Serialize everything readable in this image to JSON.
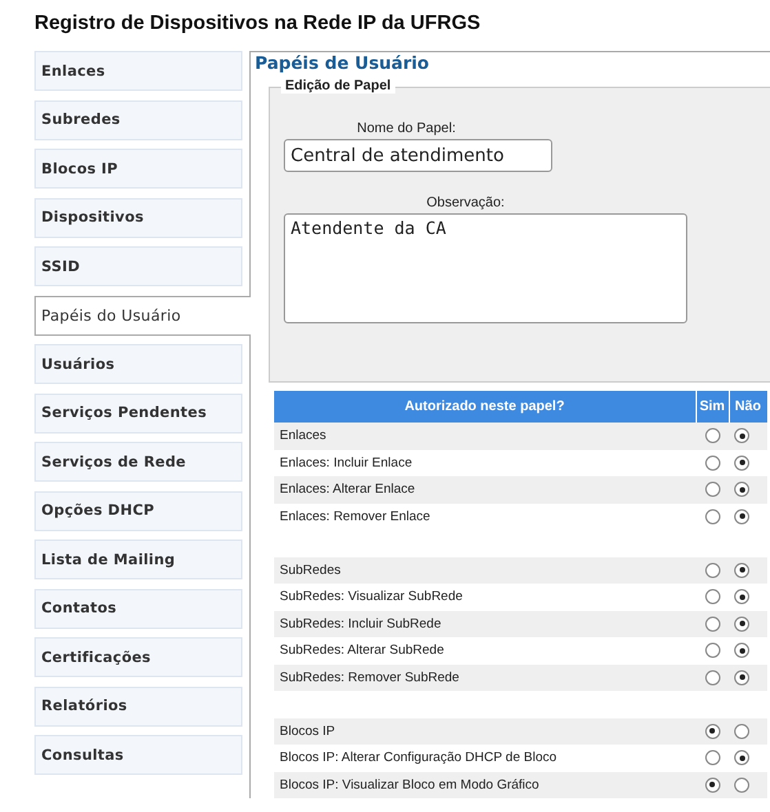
{
  "page_title": "Registro de Dispositivos na Rede IP da UFRGS",
  "sidebar": {
    "items": [
      {
        "label": "Enlaces",
        "selected": false
      },
      {
        "label": "Subredes",
        "selected": false
      },
      {
        "label": "Blocos IP",
        "selected": false
      },
      {
        "label": "Dispositivos",
        "selected": false
      },
      {
        "label": "SSID",
        "selected": false
      },
      {
        "label": "Papéis do Usuário",
        "selected": true
      },
      {
        "label": "Usuários",
        "selected": false
      },
      {
        "label": "Serviços Pendentes",
        "selected": false
      },
      {
        "label": "Serviços de Rede",
        "selected": false
      },
      {
        "label": "Opções DHCP",
        "selected": false
      },
      {
        "label": "Lista de Mailing",
        "selected": false
      },
      {
        "label": "Contatos",
        "selected": false
      },
      {
        "label": "Certificações",
        "selected": false
      },
      {
        "label": "Relatórios",
        "selected": false
      },
      {
        "label": "Consultas",
        "selected": false
      }
    ]
  },
  "content": {
    "heading": "Papéis de Usuário",
    "fieldset": {
      "legend": "Edição de Papel",
      "name_label": "Nome do Papel:",
      "name_value": "Central de atendimento",
      "obs_label": "Observação:",
      "obs_value": "Atendente da CA"
    },
    "table": {
      "columns": [
        "Autorizado neste papel?",
        "Sim",
        "Não"
      ],
      "rows": [
        {
          "kind": "permission",
          "label": "Enlaces",
          "authorized": false
        },
        {
          "kind": "permission",
          "label": "Enlaces: Incluir Enlace",
          "authorized": false
        },
        {
          "kind": "permission",
          "label": "Enlaces: Alterar Enlace",
          "authorized": false
        },
        {
          "kind": "permission",
          "label": "Enlaces: Remover Enlace",
          "authorized": false
        },
        {
          "kind": "spacer"
        },
        {
          "kind": "permission",
          "label": "SubRedes",
          "authorized": false
        },
        {
          "kind": "permission",
          "label": "SubRedes: Visualizar SubRede",
          "authorized": false
        },
        {
          "kind": "permission",
          "label": "SubRedes: Incluir SubRede",
          "authorized": false
        },
        {
          "kind": "permission",
          "label": "SubRedes: Alterar SubRede",
          "authorized": false
        },
        {
          "kind": "permission",
          "label": "SubRedes: Remover SubRede",
          "authorized": false
        },
        {
          "kind": "spacer"
        },
        {
          "kind": "permission",
          "label": "Blocos IP",
          "authorized": true
        },
        {
          "kind": "permission",
          "label": "Blocos IP: Alterar Configuração DHCP de Bloco",
          "authorized": false
        },
        {
          "kind": "permission",
          "label": "Blocos IP: Visualizar Bloco em Modo Gráfico",
          "authorized": true
        }
      ]
    }
  }
}
